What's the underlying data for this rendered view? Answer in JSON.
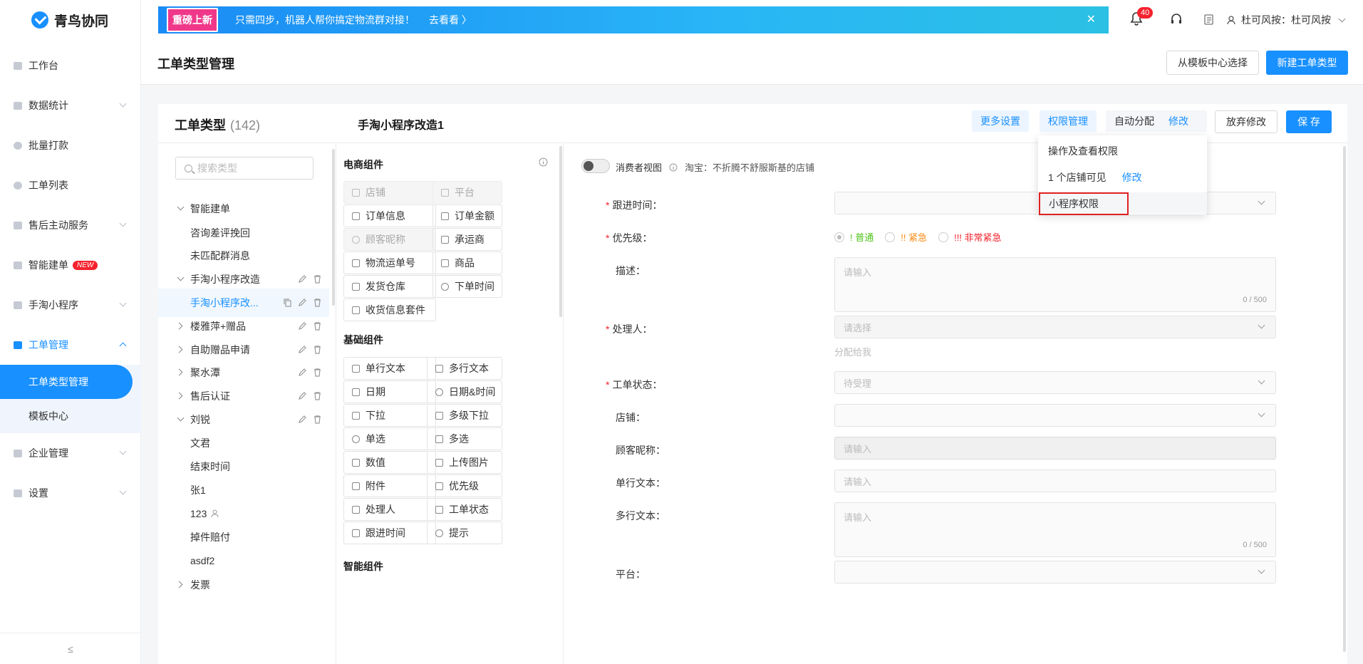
{
  "app": {
    "name": "青鸟协同"
  },
  "sidebar": {
    "items": [
      {
        "label": "工作台"
      },
      {
        "label": "数据统计"
      },
      {
        "label": "批量打款"
      },
      {
        "label": "工单列表"
      },
      {
        "label": "售后主动服务"
      },
      {
        "label": "智能建单",
        "badge": "NEW"
      },
      {
        "label": "手淘小程序"
      },
      {
        "label": "工单管理"
      },
      {
        "label": "企业管理"
      },
      {
        "label": "设置"
      }
    ],
    "subitems": [
      {
        "label": "工单类型管理"
      },
      {
        "label": "模板中心"
      }
    ],
    "collapse": "≤"
  },
  "banner": {
    "badge": "重磅上新",
    "text": "只需四步，机器人帮你搞定物流群对接！",
    "link": "去看看 〉",
    "close": "✕"
  },
  "topbar": {
    "notif_count": "40",
    "user": "杜可风按：杜可风按"
  },
  "page": {
    "title": "工单类型管理",
    "btn_template": "从模板中心选择",
    "btn_new": "新建工单类型"
  },
  "card": {
    "types_title": "工单类型",
    "types_count": "(142)",
    "current_name": "手淘小程序改造1",
    "more_settings": "更多设置",
    "perm_manage": "权限管理",
    "auto_assign": "自动分配",
    "modify": "修改",
    "discard": "放弃修改",
    "save": "保 存"
  },
  "tree": {
    "search_placeholder": "搜索类型",
    "nodes": [
      {
        "label": "智能建单"
      },
      {
        "label": "咨询差评挽回"
      },
      {
        "label": "未匹配群消息"
      },
      {
        "label": "手淘小程序改造"
      },
      {
        "label": "手淘小程序改..."
      },
      {
        "label": "楼雅萍+赠品"
      },
      {
        "label": "自助赠品申请"
      },
      {
        "label": "聚水潭"
      },
      {
        "label": "售后认证"
      },
      {
        "label": "刘锐"
      },
      {
        "label": "文君"
      },
      {
        "label": "结束时间"
      },
      {
        "label": "张1"
      },
      {
        "label": "123"
      },
      {
        "label": "掉件赔付"
      },
      {
        "label": "asdf2"
      },
      {
        "label": "发票"
      }
    ]
  },
  "components": {
    "ecom_title": "电商组件",
    "ecom": [
      "店铺",
      "平台",
      "订单信息",
      "订单金额",
      "顾客昵称",
      "承运商",
      "物流运单号",
      "商品",
      "发货仓库",
      "下单时间",
      "收货信息套件"
    ],
    "basic_title": "基础组件",
    "basic": [
      "单行文本",
      "多行文本",
      "日期",
      "日期&时间",
      "下拉",
      "多级下拉",
      "单选",
      "多选",
      "数值",
      "上传图片",
      "附件",
      "优先级",
      "处理人",
      "工单状态",
      "跟进时间",
      "提示"
    ],
    "smart_title": "智能组件"
  },
  "form": {
    "consumer_view": "消费者视图",
    "store_note": "淘宝：不折腾不舒服斯基的店铺",
    "follow_time": "跟进时间：",
    "priority": "优先级：",
    "p_normal": "! 普通",
    "p_urgent": "!! 紧急",
    "p_very": "!!! 非常紧急",
    "desc": "描述：",
    "input_ph": "请输入",
    "count": "0 / 500",
    "handler": "处理人：",
    "select_ph": "请选择",
    "assign_me": "分配给我",
    "status": "工单状态：",
    "status_val": "待受理",
    "store": "店铺：",
    "nick": "顾客昵称：",
    "single": "单行文本：",
    "multi": "多行文本：",
    "platform": "平台："
  },
  "popover": {
    "row1": "操作及查看权限",
    "row2": "1 个店铺可见",
    "row2_link": "修改",
    "row3": "小程序权限"
  },
  "colors": {
    "primary": "#1890ff",
    "red": "#f5222d",
    "green": "#52c41a",
    "orange": "#fa8c16"
  }
}
